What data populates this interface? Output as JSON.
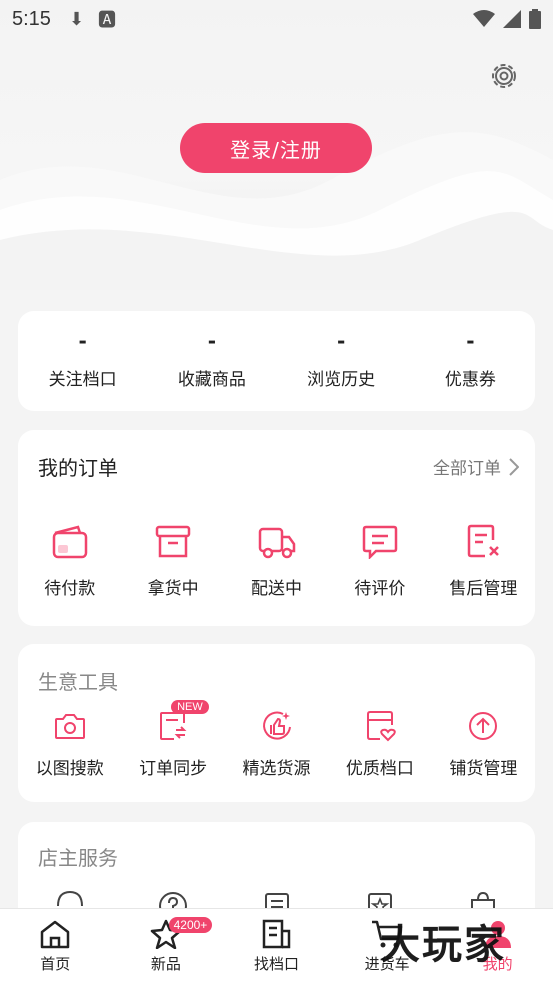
{
  "status_bar": {
    "time": "5:15",
    "icons": [
      "download-icon",
      "text-a-icon",
      "wifi-icon",
      "signal-icon",
      "battery-icon"
    ]
  },
  "header": {
    "login_label": "登录/注册",
    "settings_icon": "gear-icon"
  },
  "stats": [
    {
      "value": "-",
      "label": "关注档口"
    },
    {
      "value": "-",
      "label": "收藏商品"
    },
    {
      "value": "-",
      "label": "浏览历史"
    },
    {
      "value": "-",
      "label": "优惠券"
    }
  ],
  "orders": {
    "title": "我的订单",
    "all_label": "全部订单",
    "items": [
      {
        "label": "待付款",
        "icon": "wallet-icon"
      },
      {
        "label": "拿货中",
        "icon": "box-icon"
      },
      {
        "label": "配送中",
        "icon": "truck-icon"
      },
      {
        "label": "待评价",
        "icon": "comment-icon"
      },
      {
        "label": "售后管理",
        "icon": "receipt-cancel-icon"
      }
    ]
  },
  "tools": {
    "title": "生意工具",
    "items": [
      {
        "label": "以图搜款",
        "icon": "camera-icon"
      },
      {
        "label": "订单同步",
        "icon": "sync-doc-icon",
        "badge": "NEW"
      },
      {
        "label": "精选货源",
        "icon": "thumbs-up-icon"
      },
      {
        "label": "优质档口",
        "icon": "store-heart-icon"
      },
      {
        "label": "铺货管理",
        "icon": "upload-circle-icon"
      }
    ]
  },
  "services": {
    "title": "店主服务",
    "items": [
      {
        "icon": "headset-icon"
      },
      {
        "icon": "question-icon"
      },
      {
        "icon": "document-icon"
      },
      {
        "icon": "star-box-icon"
      },
      {
        "icon": "bag-icon"
      }
    ]
  },
  "bottom_nav": [
    {
      "label": "首页",
      "icon": "home-icon"
    },
    {
      "label": "新品",
      "icon": "star-icon",
      "badge": "4200+"
    },
    {
      "label": "找档口",
      "icon": "building-icon"
    },
    {
      "label": "进货车",
      "icon": "cart-icon"
    },
    {
      "label": "我的",
      "icon": "profile-icon",
      "active": true
    }
  ],
  "watermark": "大玩家",
  "colors": {
    "accent": "#f0446c",
    "background": "#f4f4f4"
  }
}
